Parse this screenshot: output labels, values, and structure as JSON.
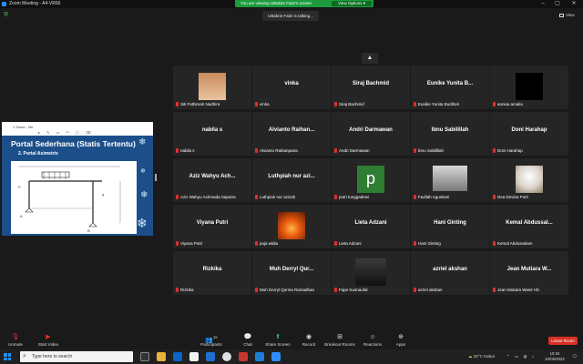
{
  "window": {
    "title": "Zoom Meeting - A4-VR66",
    "minimize": "–",
    "maximize": "▢",
    "close": "✕"
  },
  "share_banner": {
    "text": "You are viewing UBakrie Fatin's screen",
    "view_options": "View Options ▾"
  },
  "talking": "UBakrie Fatin is talking...",
  "view_button": "View",
  "shared_screen": {
    "top_label": "1 Zoom - Nn",
    "slide_title": "Portal Sederhana (Statis Tertentu)",
    "slide_subtitle": "2. Portal Asimetris"
  },
  "participants": [
    {
      "big": "",
      "label": "Siti Fathimah Nadhira",
      "pic": "anime"
    },
    {
      "big": "vinka",
      "label": "vinka"
    },
    {
      "big": "Siraj Bachmid",
      "label": "Siraj Bachmid"
    },
    {
      "big": "Eunike Yunita B...",
      "label": "Eunike Yunita Budiheri"
    },
    {
      "big": "",
      "label": "annisa amalia",
      "pic": "black"
    },
    {
      "big": "nabila s",
      "label": "nabila s"
    },
    {
      "big": "Alvianto Raihan...",
      "label": "Alvianto Raihanputra"
    },
    {
      "big": "Andri Darmawan",
      "label": "Andri Darmawan"
    },
    {
      "big": "Ibnu Sabilillah",
      "label": "Ibnu Sabilillah"
    },
    {
      "big": "Doni Harahap",
      "label": "Doni Harahap"
    },
    {
      "big": "Aziz Wahyu Ach...",
      "label": "Aziz Wahyu Achmada Saputra"
    },
    {
      "big": "Luthpiah nur azi...",
      "label": "Luthpiah nur azizah"
    },
    {
      "big": "",
      "label": "putri tunggadewi",
      "pic": "letter",
      "letter": "p"
    },
    {
      "big": "",
      "label": "Fadilah Agustiani",
      "pic": "photo_gray"
    },
    {
      "big": "",
      "label": "Dea Devina Putri",
      "pic": "cat"
    },
    {
      "big": "Viyana Putri",
      "label": "Viyana Putri"
    },
    {
      "big": "",
      "label": "puja widia",
      "pic": "fire"
    },
    {
      "big": "Lieta Adzani",
      "label": "Lieta Adzani"
    },
    {
      "big": "Hani Ginting",
      "label": "Hani Ginting"
    },
    {
      "big": "Kemal Abdussal...",
      "label": "Kemal Abdussalam"
    },
    {
      "big": "Rizkika",
      "label": "Rizkika"
    },
    {
      "big": "Muh Derryl Qur...",
      "label": "Muh Derryl Qurnia Ramadhan"
    },
    {
      "big": "",
      "label": "Fajar Kusnaufal",
      "pic": "video"
    },
    {
      "big": "azriel akshan",
      "label": "azriel akshan"
    },
    {
      "big": "Jean Mutiara W...",
      "label": "Jean Mutiara Wanir Hb"
    }
  ],
  "toolbar": {
    "unmute": "Unmute",
    "start_video": "Start Video",
    "participants": "Participants",
    "participant_count": "35",
    "chat": "Chat",
    "share_screen": "Share Screen",
    "record": "Record",
    "breakout": "Breakout Rooms",
    "reactions": "Reactions",
    "apps": "Apps",
    "leave": "Leave Room"
  },
  "taskbar": {
    "search_placeholder": "Type here to search",
    "weather": "32°C  Kabut",
    "time": "10:34",
    "date": "10/05/2022"
  }
}
